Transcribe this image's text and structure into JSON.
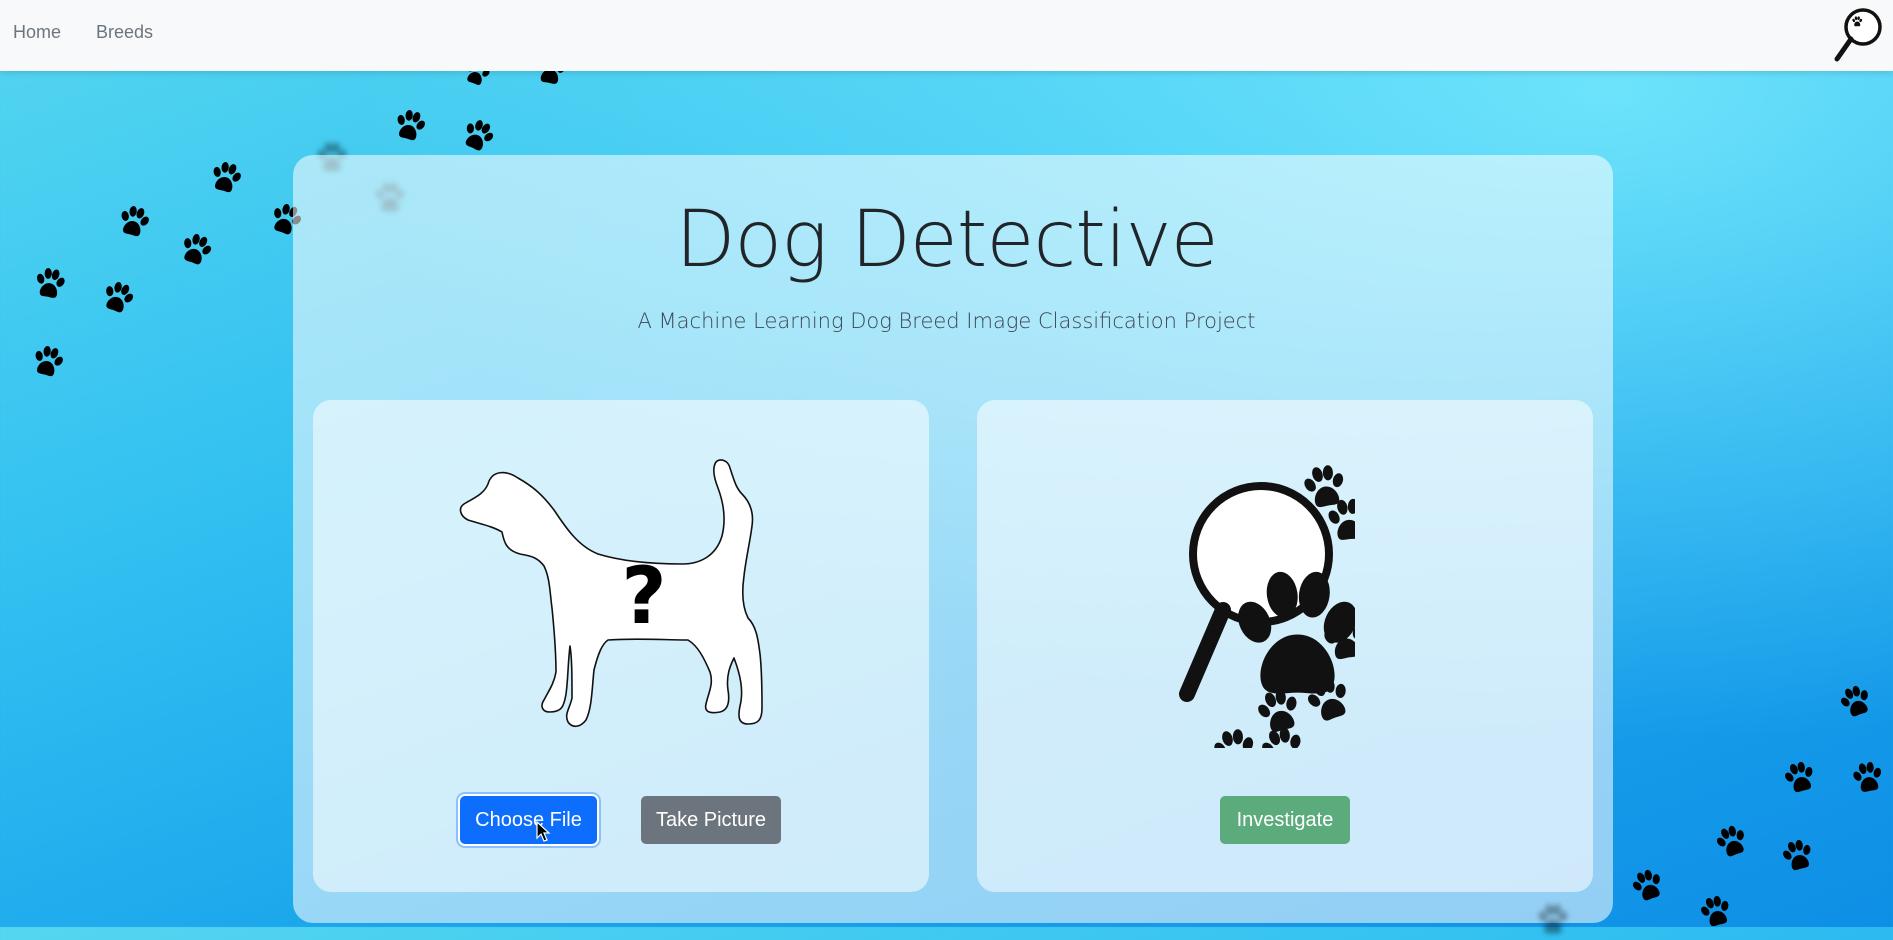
{
  "navbar": {
    "links": [
      {
        "label": "Home"
      },
      {
        "label": "Breeds"
      }
    ],
    "logo_icon": "paw-magnifier-icon"
  },
  "hero": {
    "title": "Dog Detective",
    "subtitle": "A Machine Learning Dog Breed Image Classification Project"
  },
  "upload_panel": {
    "image_icon": "dog-silhouette-question-icon",
    "choose_file_label": "Choose File",
    "take_picture_label": "Take Picture"
  },
  "result_panel": {
    "image_icon": "magnifier-paw-prints-icon",
    "investigate_label": "Investigate"
  },
  "colors": {
    "navbar_bg": "#f8f9fa",
    "primary_button": "#0d6efd",
    "secondary_button": "#6c757d",
    "success_button": "#5cab7d",
    "background_gradient": [
      "#55d6f0",
      "#0e8fe6"
    ]
  }
}
